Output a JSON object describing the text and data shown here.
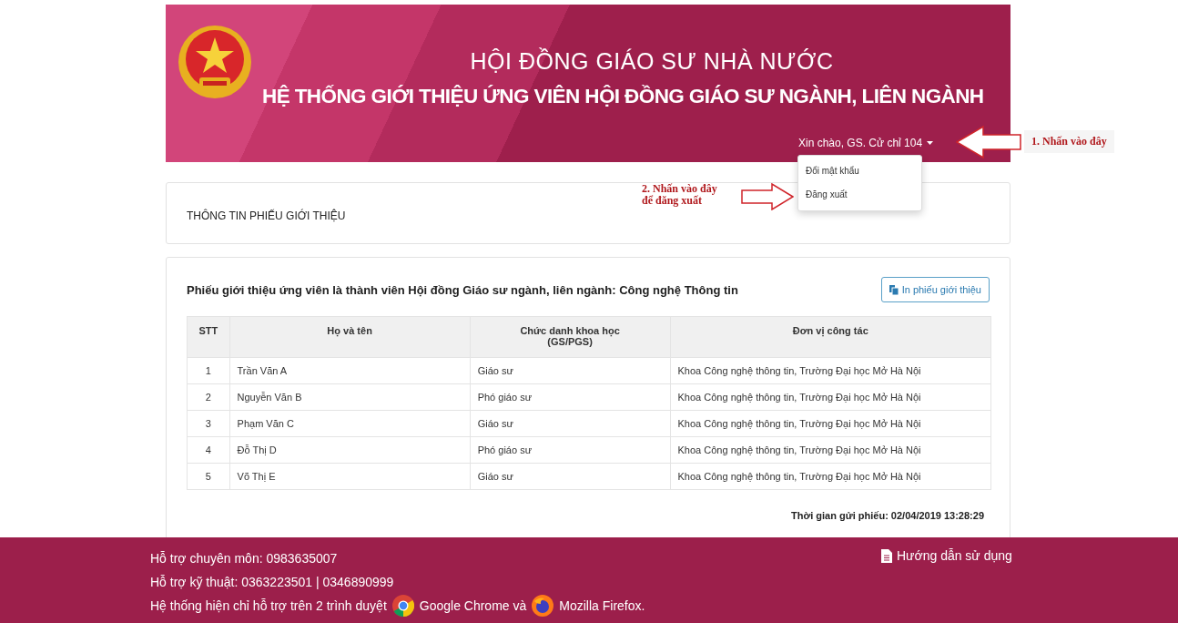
{
  "header": {
    "title": "HỘI ĐỒNG GIÁO SƯ NHÀ NƯỚC",
    "subtitle": "HỆ THỐNG GIỚI THIỆU ỨNG VIÊN HỘI ĐỒNG GIÁO SƯ NGÀNH, LIÊN NGÀNH",
    "user_menu": {
      "label": "Xin chào, GS. Cử chỉ 104",
      "expanded": true
    },
    "dropdown": [
      "Đổi mật khẩu",
      "Đăng xuất"
    ]
  },
  "annotations": [
    {
      "lines": [
        "1. Nhấn vào đây"
      ]
    },
    {
      "lines": [
        "2. Nhấn vào đây",
        "để đăng xuất"
      ]
    }
  ],
  "section_title": "THÔNG TIN PHIẾU GIỚI THIỆU",
  "card": {
    "title": "Phiếu giới thiệu ứng viên là thành viên Hội đồng Giáo sư ngành, liên ngành: Công nghệ Thông tin",
    "print_button": "In phiếu giới thiệu",
    "table": {
      "columns": [
        "STT",
        "Họ và tên",
        "Chức danh khoa học\n(GS/PGS)",
        "Đơn vị công tác"
      ],
      "rows": [
        [
          "1",
          "Trần Văn A",
          "Giáo sư",
          "Khoa Công nghệ thông tin, Trường Đại học Mở Hà Nội"
        ],
        [
          "2",
          "Nguyễn Văn B",
          "Phó giáo sư",
          "Khoa Công nghệ thông tin, Trường Đại học Mở Hà Nội"
        ],
        [
          "3",
          "Phạm Văn C",
          "Giáo sư",
          "Khoa Công nghệ thông tin, Trường Đại học Mở Hà Nội"
        ],
        [
          "4",
          "Đỗ Thị D",
          "Phó giáo sư",
          "Khoa Công nghệ thông tin, Trường Đại học Mở Hà Nội"
        ],
        [
          "5",
          "Võ Thị E",
          "Giáo sư",
          "Khoa Công nghệ thông tin, Trường Đại học Mở Hà Nội"
        ]
      ]
    },
    "sent_time": "Thời gian gửi phiếu: 02/04/2019 13:28:29"
  },
  "footer": {
    "lines": [
      "Hỗ trợ chuyên môn: 0983635007",
      "Hỗ trợ kỹ thuật: 0363223501 | 0346890999"
    ],
    "browsers_text": "Hệ thống hiện chỉ hỗ trợ trên 2 trình duyệt",
    "browser_1": "Google Chrome và",
    "browser_2": "Mozilla Firefox.",
    "guide_link": "Hướng dẫn sử dụng"
  }
}
